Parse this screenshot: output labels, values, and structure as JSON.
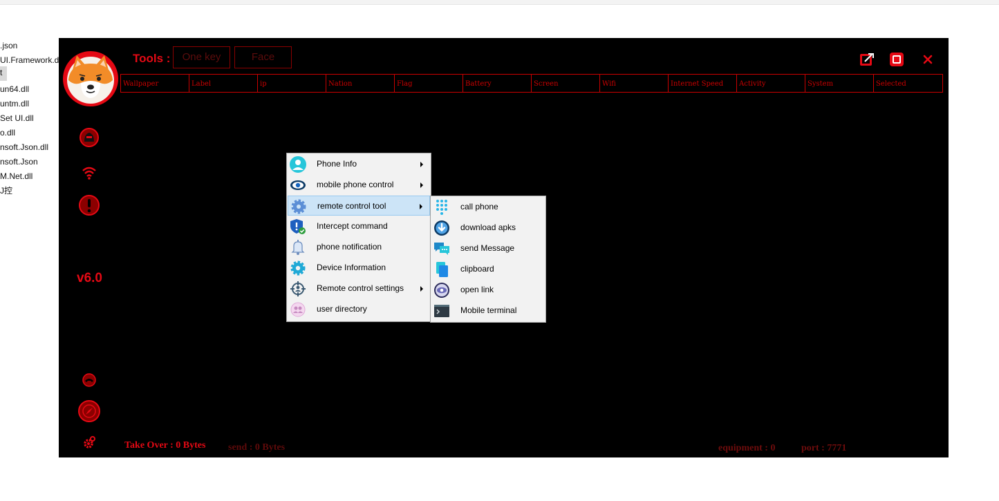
{
  "explorer": {
    "files": [
      ".json",
      "UI.Framework.dll",
      "t",
      "un64.dll",
      "untm.dll",
      "Set UI.dll",
      "o.dll",
      "nsoft.Json.dll",
      "nsoft.Json",
      "M.Net.dll",
      "J控"
    ]
  },
  "toolbar": {
    "tools_label": "Tools :",
    "one_key_label": "One key",
    "face_label": "Face"
  },
  "table": {
    "columns": [
      "Wallpaper",
      "Label",
      "ip",
      "Nation",
      "Flag",
      "Battery",
      "Screen",
      "Wifi",
      "Internet Speed",
      "Activity",
      "System",
      "Selected"
    ]
  },
  "sidebar": {
    "version": "v6.0"
  },
  "status": {
    "take_over": "Take Over : 0 Bytes",
    "send": "send : 0 Bytes",
    "equipment": "equipment : 0",
    "port": "port : 7771"
  },
  "context_menu": {
    "items": [
      {
        "label": "Phone Info",
        "icon": "person-icon"
      },
      {
        "label": "mobile phone control",
        "icon": "eye-icon"
      },
      {
        "label": "remote control tool",
        "icon": "gear-icon"
      },
      {
        "label": "Intercept command",
        "icon": "shield-icon"
      },
      {
        "label": "phone notification",
        "icon": "bell-icon"
      },
      {
        "label": "Device Information",
        "icon": "settings-gear-icon"
      },
      {
        "label": "Remote control settings",
        "icon": "target-icon"
      },
      {
        "label": "user directory",
        "icon": "contacts-icon"
      }
    ]
  },
  "submenu": {
    "items": [
      {
        "label": "call phone",
        "icon": "dialpad-icon"
      },
      {
        "label": "download apks",
        "icon": "download-icon"
      },
      {
        "label": "send Message",
        "icon": "chat-icon"
      },
      {
        "label": "clipboard",
        "icon": "clipboard-icon"
      },
      {
        "label": "open link",
        "icon": "eye-link-icon"
      },
      {
        "label": "Mobile terminal",
        "icon": "terminal-icon"
      }
    ]
  },
  "colors": {
    "accent": "#e50914",
    "background": "#000000",
    "menu_bg": "#f2f2f2",
    "menu_highlight": "#cce4f7",
    "status_dim": "#6e0c0c"
  }
}
